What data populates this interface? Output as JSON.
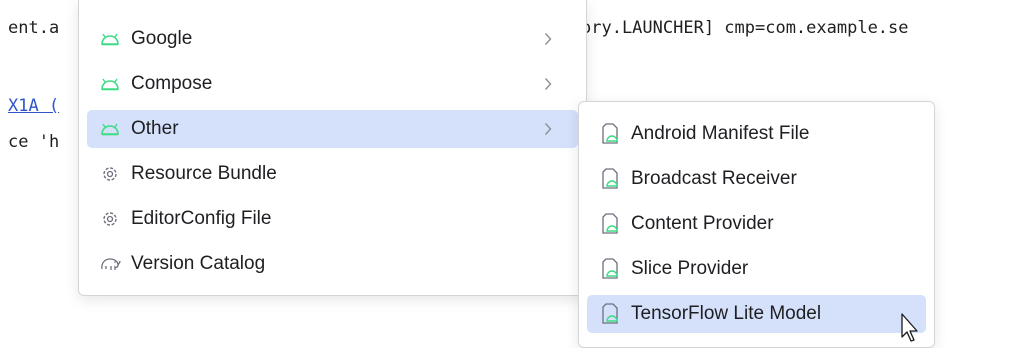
{
  "editor": {
    "line1_left": "ent.a",
    "line1_right": "ory.LAUNCHER] cmp=com.example.se",
    "line3_link": "X1A (",
    "line4": "ce 'h"
  },
  "menu": {
    "items": [
      {
        "label": "Google",
        "icon": "android-icon",
        "submenu": true
      },
      {
        "label": "Compose",
        "icon": "android-icon",
        "submenu": true
      },
      {
        "label": "Other",
        "icon": "android-icon",
        "submenu": true,
        "selected": true
      },
      {
        "label": "Resource Bundle",
        "icon": "gear-icon",
        "submenu": false
      },
      {
        "label": "EditorConfig File",
        "icon": "gear-icon",
        "submenu": false
      },
      {
        "label": "Version Catalog",
        "icon": "elephant-icon",
        "submenu": false
      }
    ]
  },
  "submenu": {
    "items": [
      {
        "label": "Android Manifest File",
        "icon": "android-file-icon"
      },
      {
        "label": "Broadcast Receiver",
        "icon": "android-file-icon"
      },
      {
        "label": "Content Provider",
        "icon": "android-file-icon"
      },
      {
        "label": "Slice Provider",
        "icon": "android-file-icon"
      },
      {
        "label": "TensorFlow Lite Model",
        "icon": "android-file-icon",
        "hovered": true
      }
    ]
  },
  "colors": {
    "selection": "#d5e1fb",
    "android_green": "#3ddc84",
    "icon_gray": "#6c707e"
  }
}
